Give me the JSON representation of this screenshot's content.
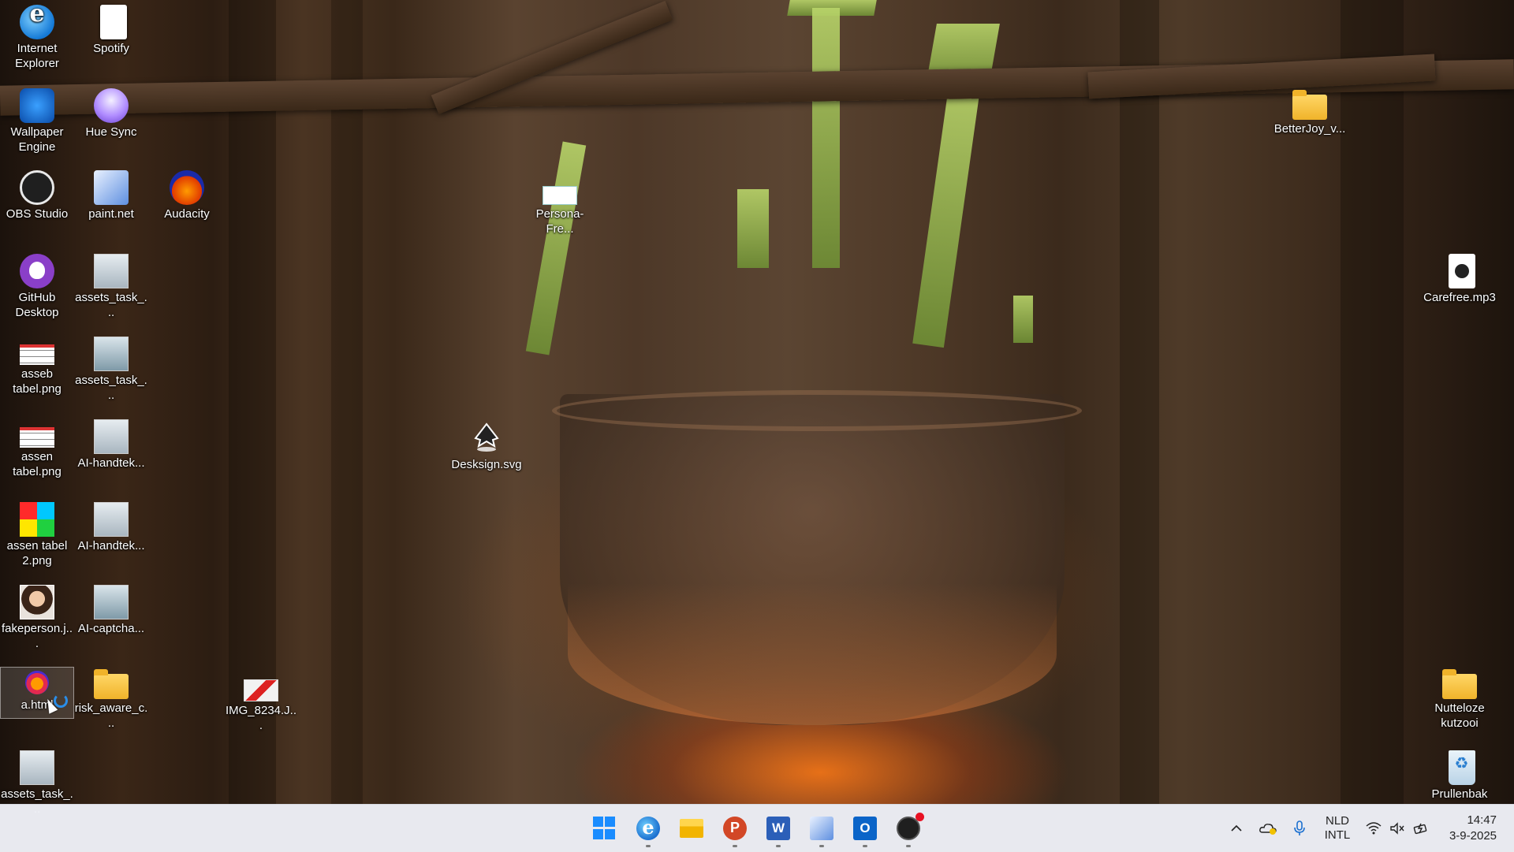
{
  "desktop": {
    "icons": [
      {
        "label": "Internet Explorer",
        "icon": "internet-explorer-icon"
      },
      {
        "label": "Spotify",
        "icon": "spotify-file-icon"
      },
      {
        "label": "Wallpaper Engine",
        "icon": "wallpaper-engine-icon"
      },
      {
        "label": "Hue Sync",
        "icon": "hue-sync-icon"
      },
      {
        "label": "OBS Studio",
        "icon": "obs-studio-icon"
      },
      {
        "label": "paint.net",
        "icon": "paint-net-icon"
      },
      {
        "label": "Audacity",
        "icon": "audacity-icon"
      },
      {
        "label": "GitHub Desktop",
        "icon": "github-desktop-icon"
      },
      {
        "label": "assets_task_...",
        "icon": "image-thumbnail-icon"
      },
      {
        "label": "asseb tabel.png",
        "icon": "png-image-icon"
      },
      {
        "label": "assets_task_...",
        "icon": "image-thumbnail-icon"
      },
      {
        "label": "assen tabel.png",
        "icon": "png-image-icon"
      },
      {
        "label": "AI-handtek...",
        "icon": "image-thumbnail-icon"
      },
      {
        "label": "assen tabel 2.png",
        "icon": "png-image-icon"
      },
      {
        "label": "AI-handtek...",
        "icon": "image-thumbnail-icon"
      },
      {
        "label": "fakeperson.j...",
        "icon": "photo-icon"
      },
      {
        "label": "AI-captcha...",
        "icon": "image-thumbnail-icon"
      },
      {
        "label": "a.html",
        "icon": "firefox-html-icon"
      },
      {
        "label": "risk_aware_c...",
        "icon": "folder-icon"
      },
      {
        "label": "IMG_8234.J...",
        "icon": "jpg-image-icon"
      },
      {
        "label": "assets_task_...",
        "icon": "image-thumbnail-icon"
      },
      {
        "label": "Persona-Fre...",
        "icon": "image-thumbnail-icon"
      },
      {
        "label": "Desksign.svg",
        "icon": "inkscape-svg-icon"
      },
      {
        "label": "BetterJoy_v...",
        "icon": "folder-icon"
      },
      {
        "label": "Carefree.mp3",
        "icon": "audio-file-icon"
      },
      {
        "label": "Nutteloze kutzooi",
        "icon": "folder-icon"
      },
      {
        "label": "Prullenbak",
        "icon": "recycle-bin-icon"
      }
    ]
  },
  "taskbar": {
    "apps": [
      {
        "name": "Start",
        "icon": "windows-start-icon"
      },
      {
        "name": "Microsoft Edge",
        "icon": "edge-icon"
      },
      {
        "name": "File Explorer",
        "icon": "file-explorer-icon"
      },
      {
        "name": "PowerPoint",
        "icon": "powerpoint-icon"
      },
      {
        "name": "Word",
        "icon": "word-icon"
      },
      {
        "name": "paint.net",
        "icon": "paint-net-icon"
      },
      {
        "name": "Outlook",
        "icon": "outlook-icon"
      },
      {
        "name": "OBS Studio",
        "icon": "obs-studio-icon"
      }
    ],
    "tray": {
      "language_line1": "NLD",
      "language_line2": "INTL",
      "time": "14:47",
      "date": "3-9-2025"
    }
  },
  "colors": {
    "accent": "#1a8cff",
    "taskbar_bg": "#eef1f7",
    "notification_badge": "#e81123"
  }
}
